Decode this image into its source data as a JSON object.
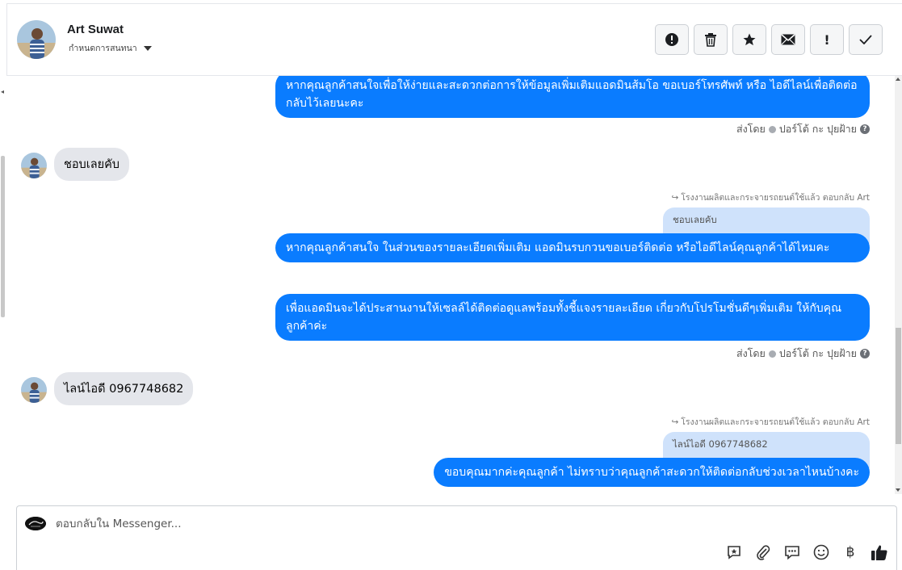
{
  "header": {
    "name": "Art Suwat",
    "assign_label": "กำหนดการสนทนา",
    "actions": [
      {
        "name": "report-icon"
      },
      {
        "name": "trash-icon"
      },
      {
        "name": "star-icon"
      },
      {
        "name": "envelope-icon"
      },
      {
        "name": "exclamation-icon"
      },
      {
        "name": "checkmark-icon"
      }
    ]
  },
  "messages": {
    "m1_text": "หากคุณลูกค้าสนใจเพื่อให้ง่ายและสะดวกต่อการให้ข้อมูลเพิ่มเติมแอดมินส้มโอ ขอเบอร์โทรศัพท์ หรือ ไอดีไลน์เพื่อติดต่อกลับไว้เลยนะคะ",
    "sent_by_1": "ส่งโดย",
    "sender_1": "ปอร์โต้ กะ ปุยฝ้าย",
    "in1_text": "ชอบเลยคับ",
    "replied_1": "โรงงานผลิตและกระจายรถยนต์ใช้แล้ว ตอบกลับ Art",
    "quote_1": "ชอบเลยคับ",
    "m2_text": "หากคุณลูกค้าสนใจ ในส่วนของรายละเอียดเพิ่มเติม แอดมินรบกวนขอเบอร์ติดต่อ หรือไอดีไลน์คุณลูกค้าได้ไหมคะ",
    "m3_text": "เพื่อแอดมินจะได้ประสานงานให้เซลล์ได้ติดต่อดูแลพร้อมทั้งชี้แจงรายละเอียด เกี่ยวกับโปรโมชั่นดีๆเพิ่มเติม ให้กับคุณลูกค้าค่ะ",
    "sent_by_2": "ส่งโดย",
    "sender_2": "ปอร์โต้ กะ ปุยฝ้าย",
    "in2_text": "ไลน์ไอดี 0967748682",
    "replied_2": "โรงงานผลิตและกระจายรถยนต์ใช้แล้ว ตอบกลับ Art",
    "quote_2": "ไลน์ไอดี 0967748682",
    "m4_text": "ขอบคุณมากค่ะคุณลูกค้า ไม่ทราบว่าคุณลูกค้าสะดวกให้ติดต่อกลับช่วงเวลาไหนบ้างคะ",
    "question_mark": "?"
  },
  "composer": {
    "placeholder": "ตอบกลับใน Messenger...",
    "tools": [
      "saved-reply-icon",
      "attach-icon",
      "chat-icon",
      "emoji-icon",
      "baht-icon",
      "like-icon"
    ],
    "baht_symbol": "฿"
  },
  "colors": {
    "outgoing_bubble": "#0a7cff",
    "incoming_bubble": "#e4e6eb",
    "quote_bubble": "#cfe2fb"
  }
}
